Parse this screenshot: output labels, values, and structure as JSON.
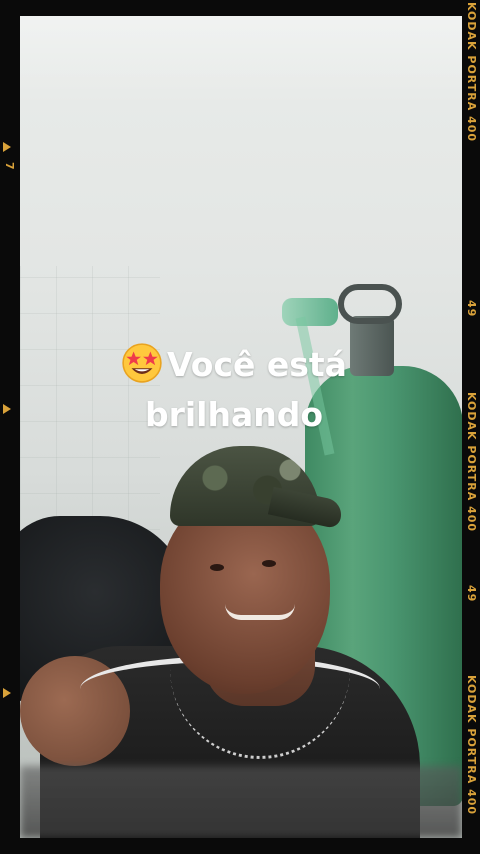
{
  "sticker": {
    "emoji_icon": "star-struck-emoji",
    "text_line1": "Você está",
    "text_line2": "brilhando"
  },
  "film_border": {
    "accent_color": "#d9a23a",
    "right_labels": [
      "KODAK PORTRA 400",
      "49",
      "KODAK PORTRA 400",
      "49",
      "KODAK PORTRA 400"
    ],
    "left_labels": [
      "7"
    ]
  }
}
